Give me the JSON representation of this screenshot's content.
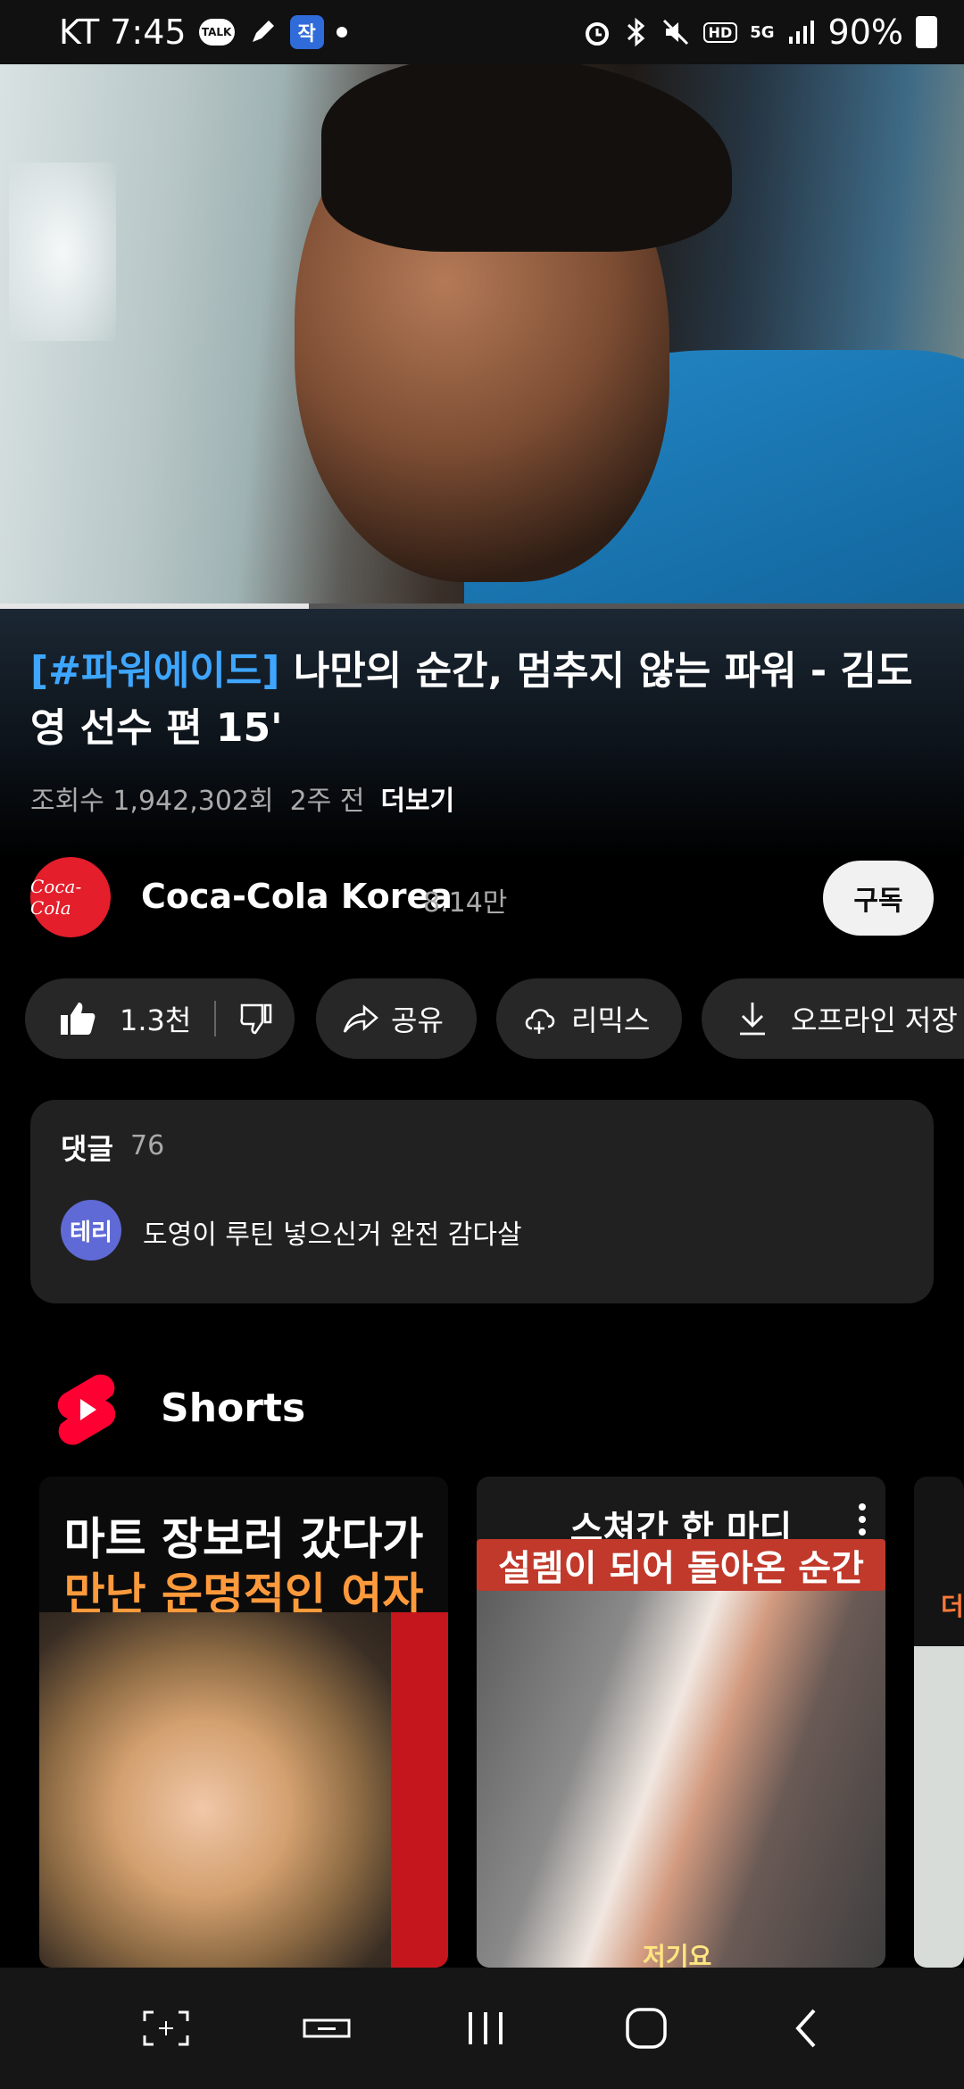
{
  "status_bar": {
    "carrier_time": "KT 7:45",
    "talk_badge": "TALK",
    "app_badge": "작",
    "hd_badge": "HD",
    "network": "5G",
    "battery": "90%"
  },
  "video": {
    "progress_fraction": 0.32,
    "title_hashtag": "[#파워에이드]",
    "title_rest": " 나만의 순간, 멈추지 않는 파워 - 김도영 선수 편 15'",
    "views": "조회수 1,942,302회",
    "age": "2주 전",
    "more": "더보기"
  },
  "channel": {
    "logo_text": "Coca-Cola",
    "name": "Coca-Cola Korea",
    "subscribers": "8.14만",
    "subscribe_label": "구독"
  },
  "actions": {
    "like_count": "1.3천",
    "share": "공유",
    "remix": "리믹스",
    "offline_save": "오프라인 저장"
  },
  "comments": {
    "header": "댓글",
    "count": "76",
    "top_author_initials": "테리",
    "top_comment": "도영이 루틴 넣으신거 완전 감다살"
  },
  "shorts": {
    "section_title": "Shorts",
    "items": [
      {
        "line1": "마트 장보러 갔다가",
        "line2": "만난 운명적인 여자"
      },
      {
        "line1": "스쳐간 한 마디",
        "line2": "설렘이 되어 돌아온 순간",
        "subtitle": "저기요"
      },
      {
        "line1": "더"
      }
    ]
  }
}
